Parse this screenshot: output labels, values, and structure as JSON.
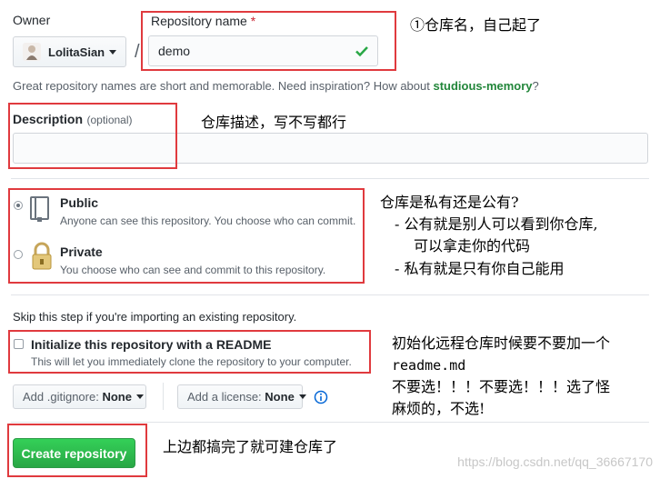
{
  "owner": {
    "label": "Owner",
    "value": "LolitaSian"
  },
  "separator": "/",
  "repo_name": {
    "label": "Repository name",
    "required_mark": "*",
    "value": "demo"
  },
  "repo_hint": {
    "prefix": "Great repository names are short and memorable. Need inspiration? How about ",
    "suggestion": "studious-memory",
    "suffix": "?"
  },
  "description": {
    "label": "Description",
    "optional": "(optional)",
    "value": ""
  },
  "visibility": {
    "public": {
      "title": "Public",
      "desc": "Anyone can see this repository. You choose who can commit.",
      "selected": true
    },
    "private": {
      "title": "Private",
      "desc": "You choose who can see and commit to this repository.",
      "selected": false
    }
  },
  "skip_text": "Skip this step if you're importing an existing repository.",
  "readme": {
    "title": "Initialize this repository with a README",
    "desc": "This will let you immediately clone the repository to your computer.",
    "checked": false
  },
  "gitignore": {
    "label": "Add .gitignore:",
    "value": "None"
  },
  "license": {
    "label": "Add a license:",
    "value": "None"
  },
  "create_button": "Create repository",
  "notes": {
    "n1": "①仓库名，自己起了",
    "n2": "仓库描述，写不写都行",
    "n3_l1": "仓库是私有还是公有?",
    "n3_l2": "- 公有就是别人可以看到你仓库,",
    "n3_l3": "可以拿走你的代码",
    "n3_l4": "- 私有就是只有你自己能用",
    "n4_l1": "初始化远程仓库时候要不要加一个",
    "n4_l2": "readme.md",
    "n4_l3": "不要选！！！不要选！！！选了怪",
    "n4_l4": "麻烦的，不选!",
    "n5": "上边都搞完了就可建仓库了"
  },
  "watermark": "https://blog.csdn.net/qq_36667170",
  "colors": {
    "annotation_red": "#e03a3e",
    "create_green": "#28a745",
    "suggestion_green": "#22863a",
    "info_blue": "#0366d6"
  }
}
